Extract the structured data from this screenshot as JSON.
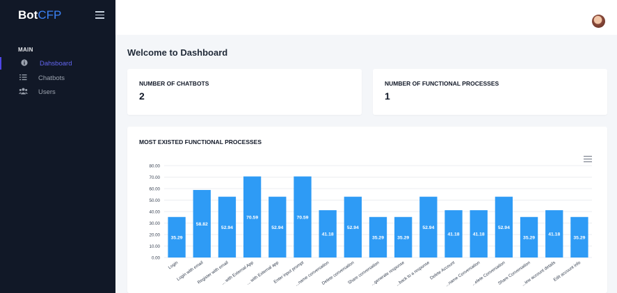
{
  "sidebar": {
    "brand_bold": "Bot",
    "brand_light": "CFP",
    "section_title": "MAIN",
    "items": [
      {
        "label": "Dahsboard",
        "icon": "info-circle-icon"
      },
      {
        "label": "Chatbots",
        "icon": "list-icon"
      },
      {
        "label": "Users",
        "icon": "users-icon"
      }
    ]
  },
  "main": {
    "page_title": "Welcome to Dashboard",
    "cards": [
      {
        "label": "NUMBER OF CHATBOTS",
        "value": "2"
      },
      {
        "label": "NUMBER OF FUNCTIONAL PROCESSES",
        "value": "1"
      }
    ],
    "chart_card": {
      "title": "MOST EXISTED FUNCTIONAL PROCESSES"
    }
  },
  "colors": {
    "accent": "#6366f1",
    "bar": "#2e9bf5",
    "sidebar": "#111827"
  },
  "chart_data": {
    "type": "bar",
    "ylim": [
      0,
      80
    ],
    "yticks": [
      "0.00",
      "10.00",
      "20.00",
      "30.00",
      "40.00",
      "50.00",
      "60.00",
      "70.00",
      "80.00"
    ],
    "categories": [
      "Login",
      "Login with email",
      "Register with email",
      "... with External App",
      "... with External app",
      "Enter input prompt",
      "...name conversation",
      "Delete conversation",
      "Share conversation",
      "...generate response",
      "...back to a response",
      "Delete Account",
      "...name Conversation",
      "...elete Conversation",
      "Share Conversation",
      "...iew account details",
      "Edit account info"
    ],
    "values": [
      35.29,
      58.82,
      52.94,
      70.59,
      52.94,
      70.59,
      41.18,
      52.94,
      35.29,
      35.29,
      52.94,
      41.18,
      41.18,
      52.94,
      35.29,
      41.18,
      35.29
    ],
    "labels": [
      "35.29",
      "58.82",
      "52.94",
      "70.59",
      "52.94",
      "70.59",
      "41.18",
      "52.94",
      "35.29",
      "35.29",
      "52.94",
      "41.18",
      "41.18",
      "52.94",
      "35.29",
      "41.18",
      "35.29"
    ],
    "grid": true
  }
}
